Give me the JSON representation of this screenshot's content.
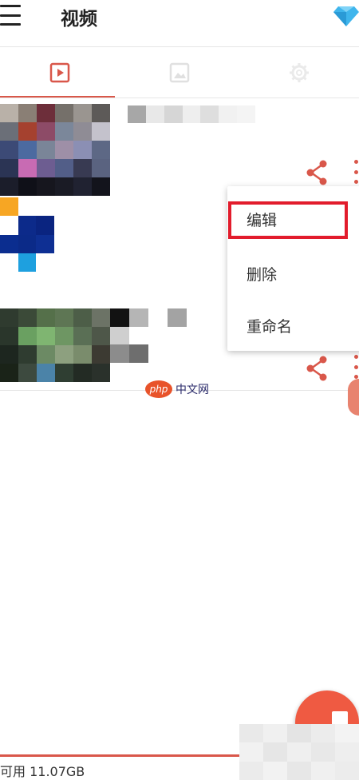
{
  "app": {
    "title": "视频"
  },
  "tabs": [
    {
      "icon": "video-play-icon",
      "active": true
    },
    {
      "icon": "image-icon",
      "active": false
    },
    {
      "icon": "settings-gear-icon",
      "active": false
    }
  ],
  "context_menu": {
    "items": [
      {
        "label": "编辑",
        "highlighted": true
      },
      {
        "label": "删除",
        "highlighted": false
      },
      {
        "label": "重命名",
        "highlighted": false
      }
    ]
  },
  "watermark": {
    "logo": "php",
    "text": "中文网"
  },
  "footer": {
    "storage_text": "可用 11.07GB"
  },
  "colors": {
    "accent": "#d9574a",
    "fab": "#ef5a42",
    "highlight_box": "#e21c2c",
    "premium": "#3fb5ec"
  }
}
